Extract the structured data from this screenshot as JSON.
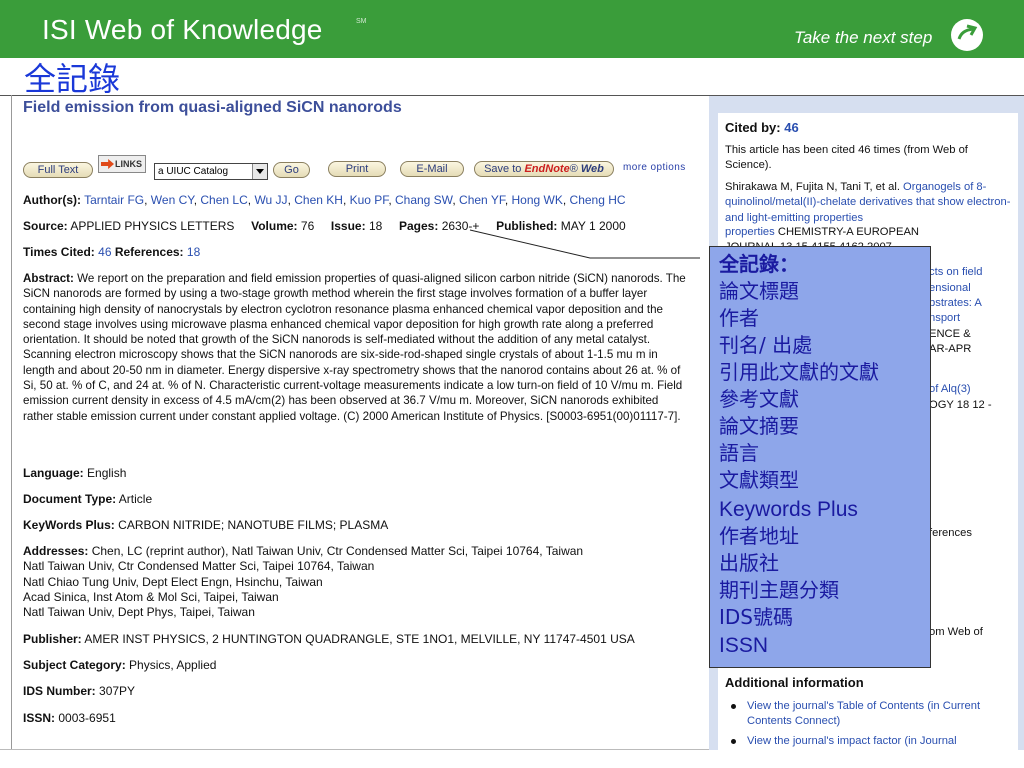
{
  "header": {
    "brand": "ISI Web of Knowledge",
    "trademark": "SM",
    "tagline": "Take the next step",
    "slide_title": "全記錄"
  },
  "colors": {
    "banner_green": "#3a9d3a",
    "link_blue": "#2a4fb0",
    "callout_blue": "#8ea6ea",
    "callout_text": "#1a1aa0"
  },
  "article": {
    "title": "Field emission from quasi-aligned SiCN nanorods"
  },
  "toolbar": {
    "full_text": "Full Text",
    "links": "LINKS",
    "catalog_value": "a UIUC Catalog",
    "go": "Go",
    "print": "Print",
    "email": "E-Mail",
    "save_to": "Save to",
    "endnote": "EndNote",
    "web": "Web",
    "more_options": "more options"
  },
  "record": {
    "authors_label": "Author(s):",
    "authors": [
      "Tarntair FG",
      "Wen CY",
      "Chen LC",
      "Wu JJ",
      "Chen KH",
      "Kuo PF",
      "Chang SW",
      "Chen YF",
      "Hong WK",
      "Cheng HC"
    ],
    "source_label": "Source:",
    "source": "APPLIED PHYSICS LETTERS",
    "volume_label": "Volume:",
    "volume": "76",
    "issue_label": "Issue:",
    "issue": "18",
    "pages_label": "Pages:",
    "pages": "2630-+",
    "published_label": "Published:",
    "published": "MAY 1 2000",
    "times_cited_label": "Times Cited:",
    "times_cited": "46",
    "references_label": "References:",
    "references": "18",
    "abstract_label": "Abstract:",
    "abstract": "We report on the preparation and field emission properties of quasi-aligned silicon carbon nitride (SiCN) nanorods. The SiCN nanorods are formed by using a two-stage growth method wherein the first stage involves formation of a buffer layer containing high density of nanocrystals by electron cyclotron resonance plasma enhanced chemical vapor deposition and the second stage involves using microwave plasma enhanced chemical vapor deposition for high growth rate along a preferred orientation. It should be noted that growth of the SiCN nanorods is self-mediated without the addition of any metal catalyst. Scanning electron microscopy shows that the SiCN nanorods are six-side-rod-shaped single crystals of about 1-1.5 mu m in length and about 20-50 nm in diameter. Energy dispersive x-ray spectrometry shows that the nanorod contains about 26 at. % of Si, 50 at. % of C, and 24 at. % of N. Characteristic current-voltage measurements indicate a low turn-on field of 10 V/mu m. Field emission current density in excess of 4.5 mA/cm(2) has been observed at 36.7 V/mu m. Moreover, SiCN nanorods exhibited rather stable emission current under constant applied voltage. (C) 2000 American Institute of Physics. [S0003-6951(00)01117-7].",
    "language_label": "Language:",
    "language": "English",
    "doctype_label": "Document Type:",
    "doctype": "Article",
    "keywords_label": "KeyWords Plus:",
    "keywords": "CARBON NITRIDE; NANOTUBE FILMS; PLASMA",
    "addresses_label": "Addresses:",
    "address_lines": [
      "Chen, LC (reprint author), Natl Taiwan Univ, Ctr Condensed Matter Sci, Taipei 10764, Taiwan",
      "Natl Taiwan Univ, Ctr Condensed Matter Sci, Taipei 10764, Taiwan",
      "Natl Chiao Tung Univ, Dept Elect Engn, Hsinchu, Taiwan",
      "Acad Sinica, Inst Atom & Mol Sci, Taipei, Taiwan",
      "Natl Taiwan Univ, Dept Phys, Taipei, Taiwan"
    ],
    "publisher_label": "Publisher:",
    "publisher": "AMER INST PHYSICS, 2 HUNTINGTON QUADRANGLE, STE 1NO1, MELVILLE, NY 11747-4501 USA",
    "subject_label": "Subject Category:",
    "subject": "Physics, Applied",
    "ids_label": "IDS Number:",
    "ids": "307PY",
    "issn_label": "ISSN:",
    "issn": "0003-6951"
  },
  "cited_by": {
    "label": "Cited by:",
    "count": "46",
    "note": "This article has been cited 46 times (from Web of Science).",
    "citing_authors": "Shirakawa M, Fujita N, Tani T, et al.",
    "citing_title": "Organogels of 8-quinolinol/metal(II)-chelate derivatives that show electron- and light-emitting properties",
    "citing_source": "CHEMISTRY-A EUROPEAN",
    "fragments": [
      "cts on field",
      "ensional",
      "bstrates: A",
      "nsport",
      "ENCE &",
      "AR-APR",
      "of Alq(3)",
      "OGY 18 12 -",
      "ferences",
      "om Web of"
    ]
  },
  "additional": {
    "heading": "Additional information",
    "items": [
      "View the journal's Table of Contents (in Current Contents Connect)",
      "View the journal's impact factor (in Journal"
    ]
  },
  "callout": {
    "items": [
      "全記錄：",
      "論文標題",
      "作者",
      "刊名/ 出處",
      "引用此文獻的文獻",
      "參考文獻",
      "論文摘要",
      "語言",
      "文獻類型",
      "Keywords Plus",
      "作者地址",
      "出版社",
      "期刊主題分類",
      "IDS號碼",
      "ISSN"
    ]
  }
}
